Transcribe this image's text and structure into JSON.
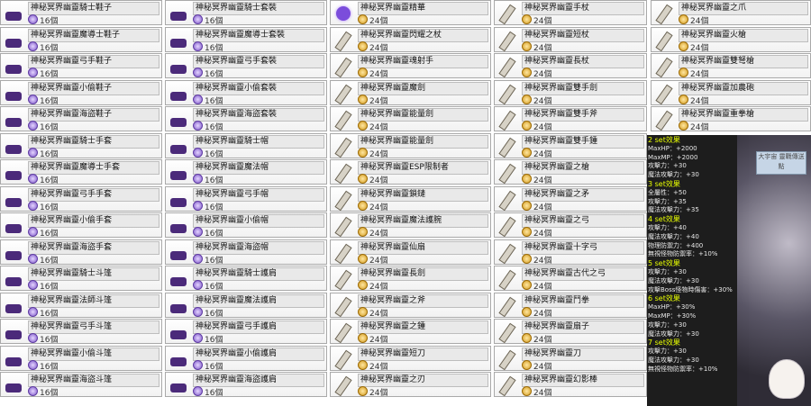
{
  "columns": [
    {
      "items": [
        {
          "name": "神秘冥界幽靈騎士鞋子",
          "count": "16個",
          "coin": "purple",
          "icon": "shoe-icon"
        },
        {
          "name": "神秘冥界幽靈魔導士鞋子",
          "count": "16個",
          "coin": "purple",
          "icon": "shoe-icon"
        },
        {
          "name": "神秘冥界幽靈弓手鞋子",
          "count": "16個",
          "coin": "purple",
          "icon": "shoe-icon"
        },
        {
          "name": "神秘冥界幽靈小偷鞋子",
          "count": "16個",
          "coin": "purple",
          "icon": "shoe-icon"
        },
        {
          "name": "神秘冥界幽靈海盜鞋子",
          "count": "16個",
          "coin": "purple",
          "icon": "shoe-icon"
        },
        {
          "name": "神秘冥界幽靈騎士手套",
          "count": "16個",
          "coin": "purple",
          "icon": "glove-icon"
        },
        {
          "name": "神秘冥界幽靈魔導士手套",
          "count": "16個",
          "coin": "purple",
          "icon": "glove-icon"
        },
        {
          "name": "神秘冥界幽靈弓手手套",
          "count": "16個",
          "coin": "purple",
          "icon": "glove-icon"
        },
        {
          "name": "神秘冥界幽靈小偷手套",
          "count": "16個",
          "coin": "purple",
          "icon": "glove-icon"
        },
        {
          "name": "神秘冥界幽靈海盜手套",
          "count": "16個",
          "coin": "purple",
          "icon": "glove-icon"
        },
        {
          "name": "神秘冥界幽靈騎士斗篷",
          "count": "16個",
          "coin": "purple",
          "icon": "cape-icon"
        },
        {
          "name": "神秘冥界幽靈法師斗篷",
          "count": "16個",
          "coin": "purple",
          "icon": "cape-icon"
        },
        {
          "name": "神秘冥界幽靈弓手斗篷",
          "count": "16個",
          "coin": "purple",
          "icon": "cape-icon"
        },
        {
          "name": "神秘冥界幽靈小偷斗篷",
          "count": "16個",
          "coin": "purple",
          "icon": "cape-icon"
        },
        {
          "name": "神秘冥界幽靈海盜斗篷",
          "count": "16個",
          "coin": "purple",
          "icon": "cape-icon"
        }
      ]
    },
    {
      "items": [
        {
          "name": "神秘冥界幽靈騎士套裝",
          "count": "16個",
          "coin": "purple",
          "icon": "armor-icon"
        },
        {
          "name": "神秘冥界幽靈魔導士套裝",
          "count": "16個",
          "coin": "purple",
          "icon": "armor-icon"
        },
        {
          "name": "神秘冥界幽靈弓手套裝",
          "count": "16個",
          "coin": "purple",
          "icon": "armor-icon"
        },
        {
          "name": "神秘冥界幽靈小偷套裝",
          "count": "16個",
          "coin": "purple",
          "icon": "armor-icon"
        },
        {
          "name": "神秘冥界幽靈海盜套裝",
          "count": "16個",
          "coin": "purple",
          "icon": "armor-icon"
        },
        {
          "name": "神秘冥界幽靈騎士帽",
          "count": "16個",
          "coin": "purple",
          "icon": "hat-icon"
        },
        {
          "name": "神秘冥界幽靈魔法帽",
          "count": "16個",
          "coin": "purple",
          "icon": "hat-icon"
        },
        {
          "name": "神秘冥界幽靈弓手帽",
          "count": "16個",
          "coin": "purple",
          "icon": "hat-icon"
        },
        {
          "name": "神秘冥界幽靈小偷帽",
          "count": "16個",
          "coin": "purple",
          "icon": "hat-icon"
        },
        {
          "name": "神秘冥界幽靈海盜帽",
          "count": "16個",
          "coin": "purple",
          "icon": "hat-icon"
        },
        {
          "name": "神秘冥界幽靈騎士護肩",
          "count": "16個",
          "coin": "purple",
          "icon": "shoulder-icon"
        },
        {
          "name": "神秘冥界幽靈魔法護肩",
          "count": "16個",
          "coin": "purple",
          "icon": "shoulder-icon"
        },
        {
          "name": "神秘冥界幽靈弓手護肩",
          "count": "16個",
          "coin": "purple",
          "icon": "shoulder-icon"
        },
        {
          "name": "神秘冥界幽靈小偷護肩",
          "count": "16個",
          "coin": "purple",
          "icon": "shoulder-icon"
        },
        {
          "name": "神秘冥界幽靈海盜護肩",
          "count": "16個",
          "coin": "purple",
          "icon": "shoulder-icon"
        }
      ]
    },
    {
      "items": [
        {
          "name": "神秘冥界幽靈精華",
          "count": "24個",
          "coin": "gold",
          "icon": "orb-icon"
        },
        {
          "name": "神秘冥界幽靈閃耀之杖",
          "count": "24個",
          "coin": "gold",
          "icon": "staff-icon"
        },
        {
          "name": "神秘冥界幽靈魂射手",
          "count": "24個",
          "coin": "gold",
          "icon": "weapon-icon"
        },
        {
          "name": "神秘冥界幽靈魔劍",
          "count": "24個",
          "coin": "gold",
          "icon": "sword-icon"
        },
        {
          "name": "神秘冥界幽靈能量劍",
          "count": "24個",
          "coin": "gold",
          "icon": "sword-icon"
        },
        {
          "name": "神秘冥界幽靈能量劍",
          "count": "24個",
          "coin": "gold",
          "icon": "sword-icon"
        },
        {
          "name": "神秘冥界幽靈ESP限制者",
          "count": "24個",
          "coin": "gold",
          "icon": "weapon-icon"
        },
        {
          "name": "神秘冥界幽靈鎖鏈",
          "count": "24個",
          "coin": "gold",
          "icon": "chain-icon"
        },
        {
          "name": "神秘冥界幽靈魔法護腕",
          "count": "24個",
          "coin": "gold",
          "icon": "bracer-icon"
        },
        {
          "name": "神秘冥界幽靈仙扇",
          "count": "24個",
          "coin": "gold",
          "icon": "fan-icon"
        },
        {
          "name": "神秘冥界幽靈長劍",
          "count": "24個",
          "coin": "gold",
          "icon": "sword-icon"
        },
        {
          "name": "神秘冥界幽靈之斧",
          "count": "24個",
          "coin": "gold",
          "icon": "axe-icon"
        },
        {
          "name": "神秘冥界幽靈之鍾",
          "count": "24個",
          "coin": "gold",
          "icon": "hammer-icon"
        },
        {
          "name": "神秘冥界幽靈短刀",
          "count": "24個",
          "coin": "gold",
          "icon": "dagger-icon"
        },
        {
          "name": "神秘冥界幽靈之刃",
          "count": "24個",
          "coin": "gold",
          "icon": "blade-icon"
        }
      ]
    },
    {
      "items": [
        {
          "name": "神秘冥界幽靈手杖",
          "count": "24個",
          "coin": "gold",
          "icon": "staff-icon"
        },
        {
          "name": "神秘冥界幽靈短杖",
          "count": "24個",
          "coin": "gold",
          "icon": "staff-icon"
        },
        {
          "name": "神秘冥界幽靈長杖",
          "count": "24個",
          "coin": "gold",
          "icon": "staff-icon"
        },
        {
          "name": "神秘冥界幽靈雙手劍",
          "count": "24個",
          "coin": "gold",
          "icon": "sword-icon"
        },
        {
          "name": "神秘冥界幽靈雙手斧",
          "count": "24個",
          "coin": "gold",
          "icon": "axe-icon"
        },
        {
          "name": "神秘冥界幽靈雙手鍾",
          "count": "24個",
          "coin": "gold",
          "icon": "hammer-icon"
        },
        {
          "name": "神秘冥界幽靈之槍",
          "count": "24個",
          "coin": "gold",
          "icon": "spear-icon"
        },
        {
          "name": "神秘冥界幽靈之矛",
          "count": "24個",
          "coin": "gold",
          "icon": "spear-icon"
        },
        {
          "name": "神秘冥界幽靈之弓",
          "count": "24個",
          "coin": "gold",
          "icon": "bow-icon"
        },
        {
          "name": "神秘冥界幽靈十字弓",
          "count": "24個",
          "coin": "gold",
          "icon": "crossbow-icon"
        },
        {
          "name": "神秘冥界幽靈古代之弓",
          "count": "24個",
          "coin": "gold",
          "icon": "bow-icon"
        },
        {
          "name": "神秘冥界幽靈鬥拳",
          "count": "24個",
          "coin": "gold",
          "icon": "knuckle-icon"
        },
        {
          "name": "神秘冥界幽靈扇子",
          "count": "24個",
          "coin": "gold",
          "icon": "fan-icon"
        },
        {
          "name": "神秘冥界幽靈刀",
          "count": "24個",
          "coin": "gold",
          "icon": "blade-icon"
        },
        {
          "name": "神秘冥界幽靈幻影棒",
          "count": "24個",
          "coin": "gold",
          "icon": "wand-icon"
        }
      ]
    },
    {
      "items": [
        {
          "name": "神秘冥界幽靈之爪",
          "count": "24個",
          "coin": "gold",
          "icon": "claw-icon"
        },
        {
          "name": "神秘冥界幽靈火槍",
          "count": "24個",
          "coin": "gold",
          "icon": "gun-icon"
        },
        {
          "name": "神秘冥界幽靈雙弩槍",
          "count": "24個",
          "coin": "gold",
          "icon": "gun-icon"
        },
        {
          "name": "神秘冥界幽靈加農砲",
          "count": "24個",
          "coin": "gold",
          "icon": "cannon-icon"
        },
        {
          "name": "神秘冥界幽靈重拳槍",
          "count": "24個",
          "coin": "gold",
          "icon": "gun-icon"
        }
      ]
    }
  ],
  "set_effects": {
    "lines": [
      {
        "text": "2 set效果",
        "header": true
      },
      {
        "text": "MaxHP：+2000",
        "header": false
      },
      {
        "text": "MaxMP：+2000",
        "header": false
      },
      {
        "text": "攻擊力：+30",
        "header": false
      },
      {
        "text": "魔法攻擊力：+30",
        "header": false
      },
      {
        "text": "3 set效果",
        "header": true
      },
      {
        "text": "全屬性：+50",
        "header": false
      },
      {
        "text": "攻擊力：+35",
        "header": false
      },
      {
        "text": "魔法攻擊力：+35",
        "header": false
      },
      {
        "text": "4 set效果",
        "header": true
      },
      {
        "text": "攻擊力：+40",
        "header": false
      },
      {
        "text": "魔法攻擊力：+40",
        "header": false
      },
      {
        "text": "物理防禦力：+400",
        "header": false
      },
      {
        "text": "無視怪物防禦率：+10%",
        "header": false
      },
      {
        "text": "5 set效果",
        "header": true
      },
      {
        "text": "攻擊力：+30",
        "header": false
      },
      {
        "text": "魔法攻擊力：+30",
        "header": false
      },
      {
        "text": "攻擊Boss怪物時傷害：+30%",
        "header": false
      },
      {
        "text": "6 set效果",
        "header": true
      },
      {
        "text": "MaxHP：+30%",
        "header": false
      },
      {
        "text": "MaxMP：+30%",
        "header": false
      },
      {
        "text": "攻擊力：+30",
        "header": false
      },
      {
        "text": "魔法攻擊力：+30",
        "header": false
      },
      {
        "text": "7 set效果",
        "header": true
      },
      {
        "text": "攻擊力：+30",
        "header": false
      },
      {
        "text": "魔法攻擊力：+30",
        "header": false
      },
      {
        "text": "無視怪物防禦率：+10%",
        "header": false
      }
    ],
    "sign": "大宇宙 靈戰傳送點"
  },
  "colors": {
    "border": "#a9a9a9",
    "panel_bg": "#141414",
    "effect_header": "#e8ff00",
    "effect_text": "#e8e8e8"
  }
}
